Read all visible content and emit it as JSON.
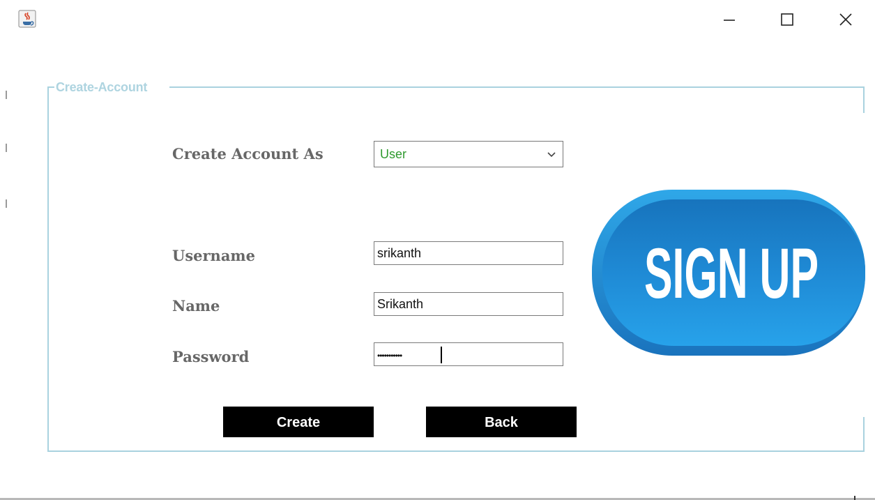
{
  "window": {
    "app_icon": "java-cup-icon",
    "controls": [
      "minimize-icon",
      "maximize-icon",
      "close-icon"
    ]
  },
  "form": {
    "legend": "Create-Account",
    "account_type": {
      "label": "Create Account As",
      "selected": "User"
    },
    "username": {
      "label": "Username",
      "value": "srikanth"
    },
    "name": {
      "label": "Name",
      "value": "Srikanth"
    },
    "password": {
      "label": "Password",
      "masked_value": "•••••••••••"
    },
    "buttons": {
      "create": "Create",
      "back": "Back"
    }
  },
  "banner": {
    "text": "SIGN UP"
  },
  "colors": {
    "frame_border": "#a9d2df",
    "label_text": "#676767",
    "select_text": "#2f9a2f",
    "button_bg": "#000000",
    "badge_blue": "#1f8bd3"
  }
}
